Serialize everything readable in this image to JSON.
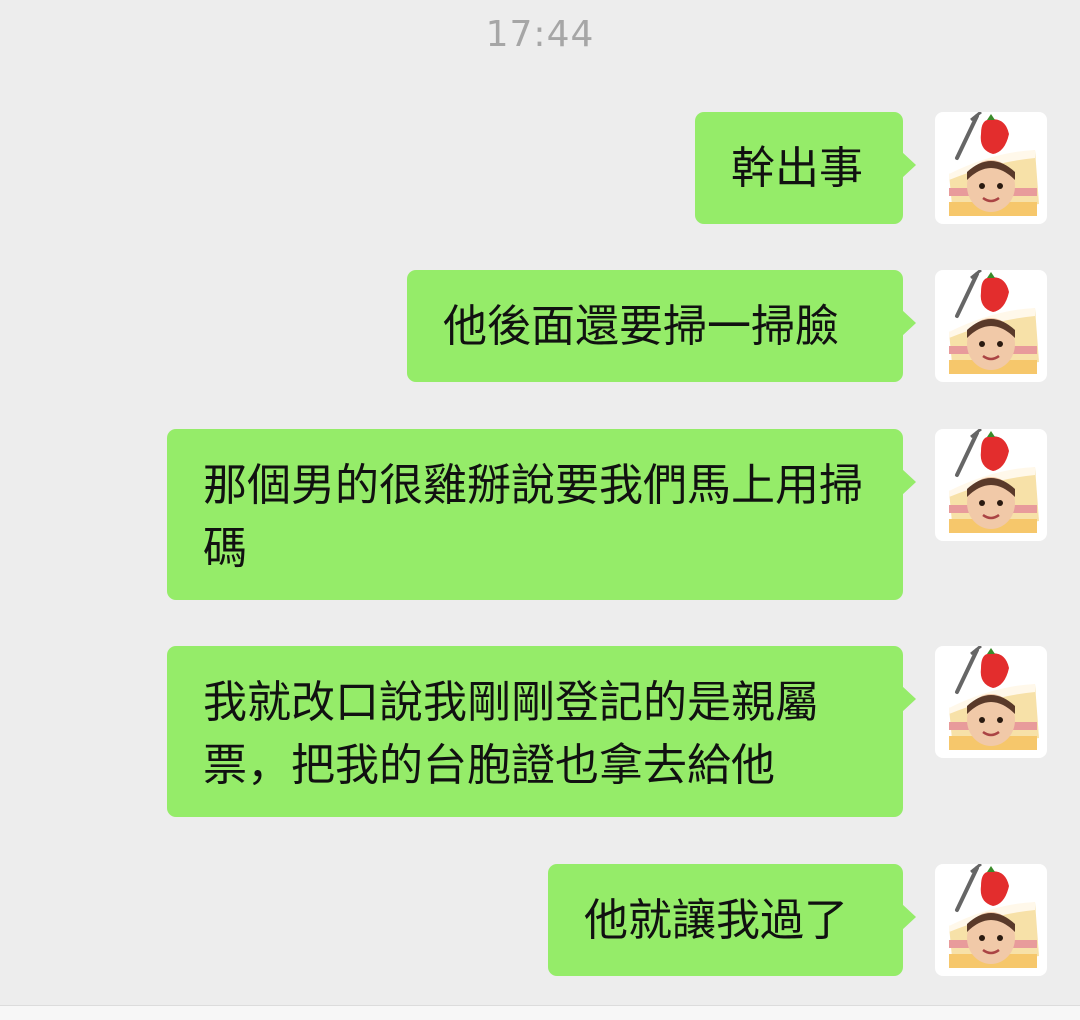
{
  "chat": {
    "timestamp": "17:44",
    "messages": [
      {
        "text": "幹出事",
        "sender": "self"
      },
      {
        "text": "他後面還要掃一掃臉",
        "sender": "self"
      },
      {
        "text": "那個男的很雞掰說要我們馬上用掃碼",
        "sender": "self"
      },
      {
        "text": "我就改口說我剛剛登記的是親屬票，把我的台胞證也拿去給他",
        "sender": "self"
      },
      {
        "text": "他就讓我過了",
        "sender": "self"
      }
    ]
  },
  "colors": {
    "background": "#ededed",
    "bubble_self": "#95ec69",
    "timestamp_text": "#a6a6a6"
  },
  "icons": {
    "avatar": "cake-avatar-icon"
  }
}
